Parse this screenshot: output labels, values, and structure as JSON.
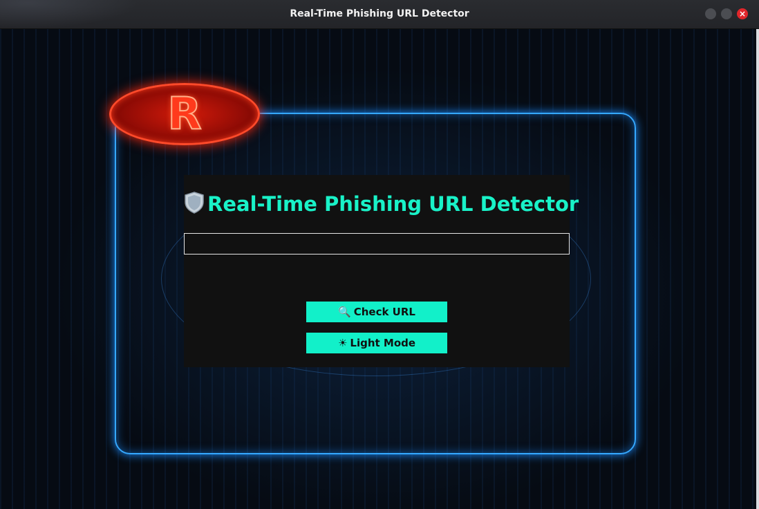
{
  "window": {
    "title": "Real-Time Phishing URL Detector",
    "close_glyph": "×"
  },
  "logo": {
    "letter": "R"
  },
  "app": {
    "heading": "Real-Time Phishing URL Detector",
    "heading_icon": "shield-icon",
    "url_input": {
      "value": "",
      "placeholder": ""
    },
    "check_button": {
      "icon": "🔍",
      "label": "Check URL"
    },
    "theme_button": {
      "icon": "☀",
      "label": "Light Mode"
    }
  },
  "colors": {
    "accent": "#12f0c9",
    "panel_bg": "#111111",
    "frame_glow": "#35a8ff",
    "logo_red": "#ff3a1c"
  }
}
